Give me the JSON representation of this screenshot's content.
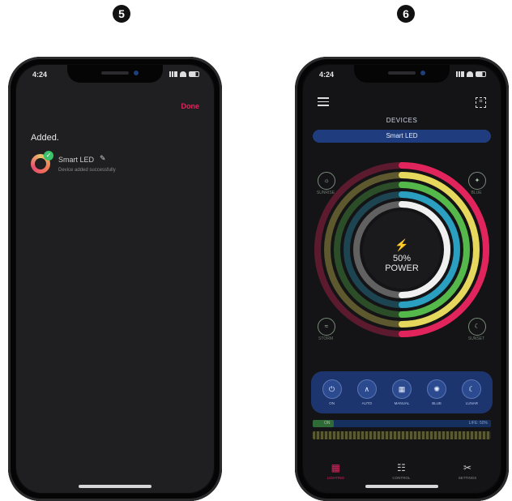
{
  "steps": [
    "5",
    "6"
  ],
  "status_bar": {
    "time": "4:24"
  },
  "phone1": {
    "done_label": "Done",
    "heading": "Added.",
    "device": {
      "name": "Smart LED",
      "subtitle": "Device added successfully",
      "icon": "pencil-icon"
    }
  },
  "phone2": {
    "title": "DEVICES",
    "device_name": "Smart LED",
    "power": {
      "percent": "50%",
      "label": "POWER"
    },
    "corner_buttons": [
      {
        "label": "SUNRISE",
        "glyph": "☼"
      },
      {
        "label": "BLUE",
        "glyph": "✦"
      },
      {
        "label": "STORM",
        "glyph": "≈"
      },
      {
        "label": "SUNSET",
        "glyph": "☾"
      }
    ],
    "modes": [
      {
        "label": "ON",
        "glyph": "⏻"
      },
      {
        "label": "AUTO",
        "glyph": "∧"
      },
      {
        "label": "MANUAL",
        "glyph": "▦"
      },
      {
        "label": "BLUE",
        "glyph": "✺"
      },
      {
        "label": "LUNAR",
        "glyph": "☾"
      }
    ],
    "timeline": {
      "left_label": "ON",
      "right_label": "LIFE: 50%",
      "fill_fraction": 0.12
    },
    "tabs": [
      {
        "label": "LIGHTING",
        "glyph": "▦",
        "active": true
      },
      {
        "label": "CONTROL",
        "glyph": "☷",
        "active": false
      },
      {
        "label": "SETTINGS",
        "glyph": "✂",
        "active": false
      }
    ],
    "ring_colors": [
      "#e2245c",
      "#e6d85c",
      "#55b84a",
      "#2a9fc0",
      "#f0f0f0"
    ]
  }
}
